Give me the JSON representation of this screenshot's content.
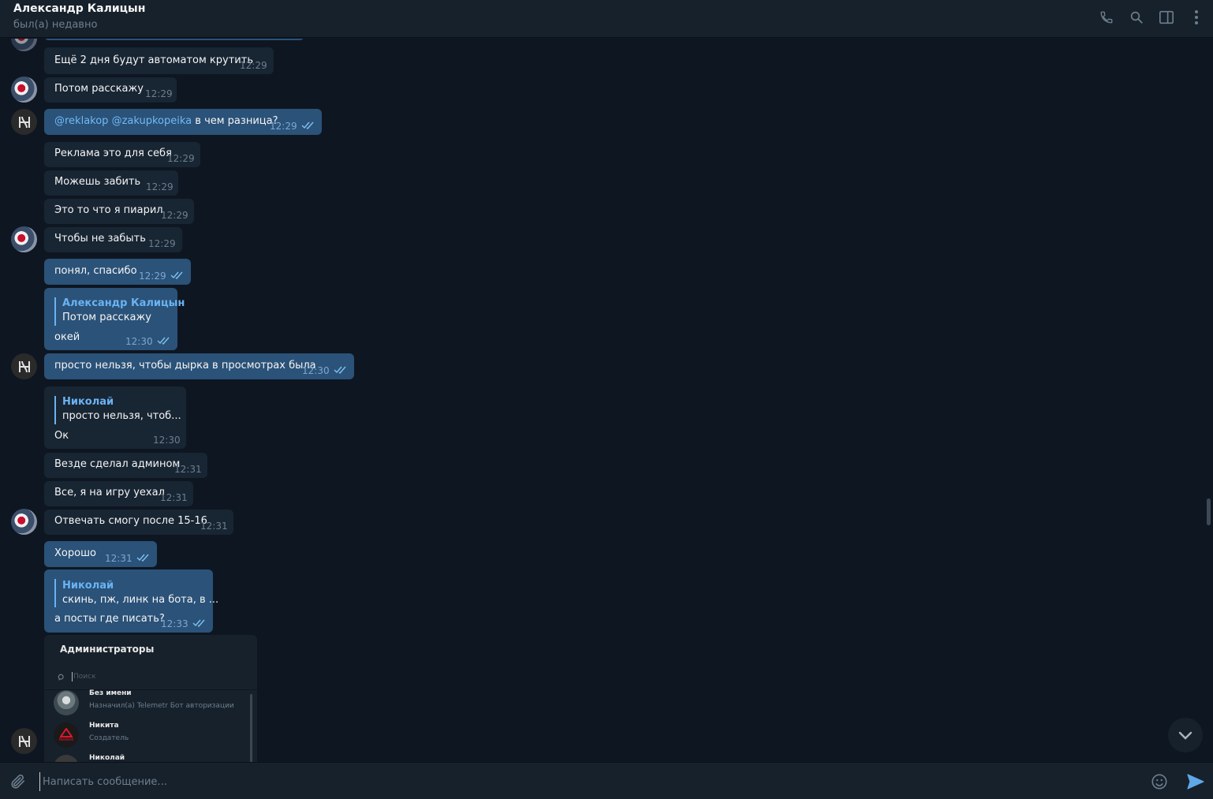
{
  "header": {
    "name": "Александр Калицын",
    "status": "был(а) недавно"
  },
  "messages": [
    {
      "text": "Ещё 2 дня будут автоматом крутить",
      "time": "12:29"
    },
    {
      "text": "Потом расскажу",
      "time": "12:29"
    },
    {
      "mention1": "@reklakop",
      "mention2": "@zakupkopeika",
      "text": " в чем разница?",
      "time": "12:29"
    },
    {
      "text": "Реклама это для себя",
      "time": "12:29"
    },
    {
      "text": "Можешь забить",
      "time": "12:29"
    },
    {
      "text": "Это то что я пиарил",
      "time": "12:29"
    },
    {
      "text": "Чтобы не забыть",
      "time": "12:29"
    },
    {
      "text": "понял, спасибо",
      "time": "12:29"
    },
    {
      "reply_name": "Александр Калицын",
      "reply_text": "Потом расскажу",
      "text": "окей",
      "time": "12:30"
    },
    {
      "text": "просто нельзя, чтобы дырка в просмотрах была",
      "time": "12:30"
    },
    {
      "reply_name": "Николай",
      "reply_text": "просто нельзя, чтоб...",
      "text": "Ок",
      "time": "12:30"
    },
    {
      "text": "Везде сделал админом",
      "time": "12:31"
    },
    {
      "text": "Все, я на игру уехал",
      "time": "12:31"
    },
    {
      "text": "Отвечать смогу после 15-16",
      "time": "12:31"
    },
    {
      "text": "Хорошо",
      "time": "12:31"
    },
    {
      "reply_name": "Николай",
      "reply_text": "скинь, пж, линк на бота, в ...",
      "text": "а посты где писать?",
      "time": "12:33"
    }
  ],
  "screenshot": {
    "title": "Администраторы",
    "search_placeholder": "Поиск",
    "rows": [
      {
        "name": "Без имени",
        "sub": "Назначил(а) Telemetr Бот авторизации"
      },
      {
        "name": "Никита",
        "sub": "Создатель",
        "logo_text": "Reebok"
      },
      {
        "name": "Николай",
        "sub": ""
      }
    ]
  },
  "composer": {
    "placeholder": "Написать сообщение..."
  },
  "colors": {
    "background": "#0e1621",
    "panel": "#17212b",
    "incoming_bubble": "#182533",
    "outgoing_bubble": "#2b5278",
    "accent": "#6ab3f3"
  },
  "icons": [
    "phone-icon",
    "search-icon",
    "sidebar-toggle-icon",
    "more-vertical-icon",
    "attach-icon",
    "emoji-icon",
    "send-icon",
    "chevron-down-icon",
    "double-check-icon"
  ]
}
